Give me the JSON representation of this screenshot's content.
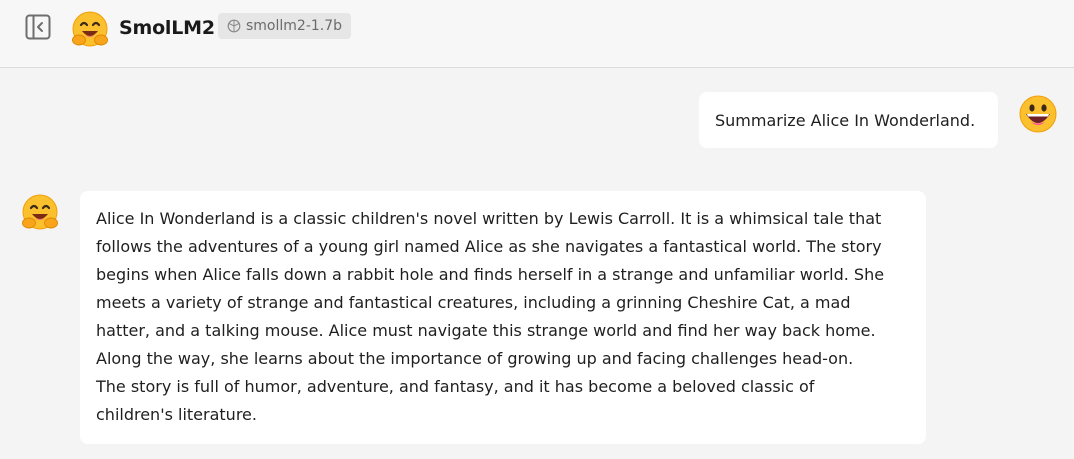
{
  "header": {
    "toggle_icon": "sidebar-collapse-icon",
    "logo_icon": "hugging-face-emoji",
    "title": "SmolLM2",
    "model_badge": {
      "icon": "model-cube-icon",
      "label": "smollm2-1.7b"
    }
  },
  "conversation": {
    "user_message": {
      "avatar": "grinning-face-with-tongue-emoji",
      "text": "Summarize Alice In Wonderland."
    },
    "assistant_message": {
      "avatar": "hugging-face-emoji",
      "lines": [
        "Alice In Wonderland is a classic children's novel written by Lewis Carroll. It is a whimsical tale that",
        "follows the adventures of a young girl named Alice as she navigates a fantastical world. The story",
        "begins when Alice falls down a rabbit hole and finds herself in a strange and unfamiliar world. She",
        "meets a variety of strange and fantastical creatures, including a grinning Cheshire Cat, a mad",
        "hatter, and a talking mouse. Alice must navigate this strange world and find her way back home.",
        "Along the way, she learns about the importance of growing up and facing challenges head-on.",
        "The story is full of humor, adventure, and fantasy, and it has become a beloved classic of",
        "children's literature."
      ]
    }
  },
  "colors": {
    "page_background": "#f4f4f4",
    "bubble_background": "#ffffff",
    "badge_background": "#e6e6e6",
    "emoji_yellow": "#f9b90f"
  }
}
